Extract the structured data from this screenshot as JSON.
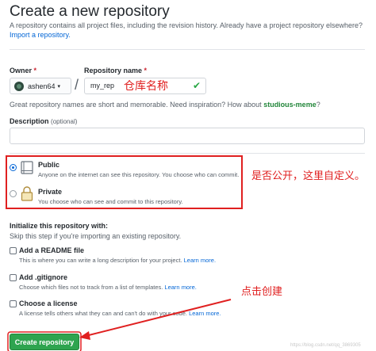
{
  "header": {
    "title": "Create a new repository",
    "description": "A repository contains all project files, including the revision history. Already have a project repository elsewhere?",
    "import_link": "Import a repository."
  },
  "owner": {
    "label": "Owner",
    "required_mark": "*",
    "value": "ashen64",
    "caret": "▾"
  },
  "repo": {
    "label": "Repository name",
    "required_mark": "*",
    "separator": "/",
    "value": "my_rep",
    "valid_icon": "✔"
  },
  "annotations": {
    "repo_name": "仓库名称",
    "visibility": "是否公开，这里自定义。",
    "create": "点击创建",
    "color": "#e02020"
  },
  "hint": {
    "text": "Great repository names are short and memorable. Need inspiration? How about",
    "suggestion": "studious-meme",
    "end": "?"
  },
  "description_field": {
    "label": "Description",
    "optional": "(optional)",
    "value": ""
  },
  "visibility": {
    "public": {
      "title": "Public",
      "desc": "Anyone on the internet can see this repository. You choose who can commit.",
      "selected": true,
      "icon": "repo-icon"
    },
    "private": {
      "title": "Private",
      "desc": "You choose who can see and commit to this repository.",
      "selected": false,
      "icon": "lock-icon"
    }
  },
  "init": {
    "title": "Initialize this repository with:",
    "subtitle": "Skip this step if you're importing an existing repository.",
    "options": [
      {
        "title": "Add a README file",
        "desc": "This is where you can write a long description for your project.",
        "link": "Learn more."
      },
      {
        "title": "Add .gitignore",
        "desc": "Choose which files not to track from a list of templates.",
        "link": "Learn more."
      },
      {
        "title": "Choose a license",
        "desc": "A license tells others what they can and can't do with your code.",
        "link": "Learn more."
      }
    ]
  },
  "create_button": "Create repository",
  "watermark": "https://blog.csdn.net/qq_3869305",
  "colors": {
    "primary_button": "#2ea44f",
    "link": "#0366d6",
    "suggestion": "#22863a"
  }
}
